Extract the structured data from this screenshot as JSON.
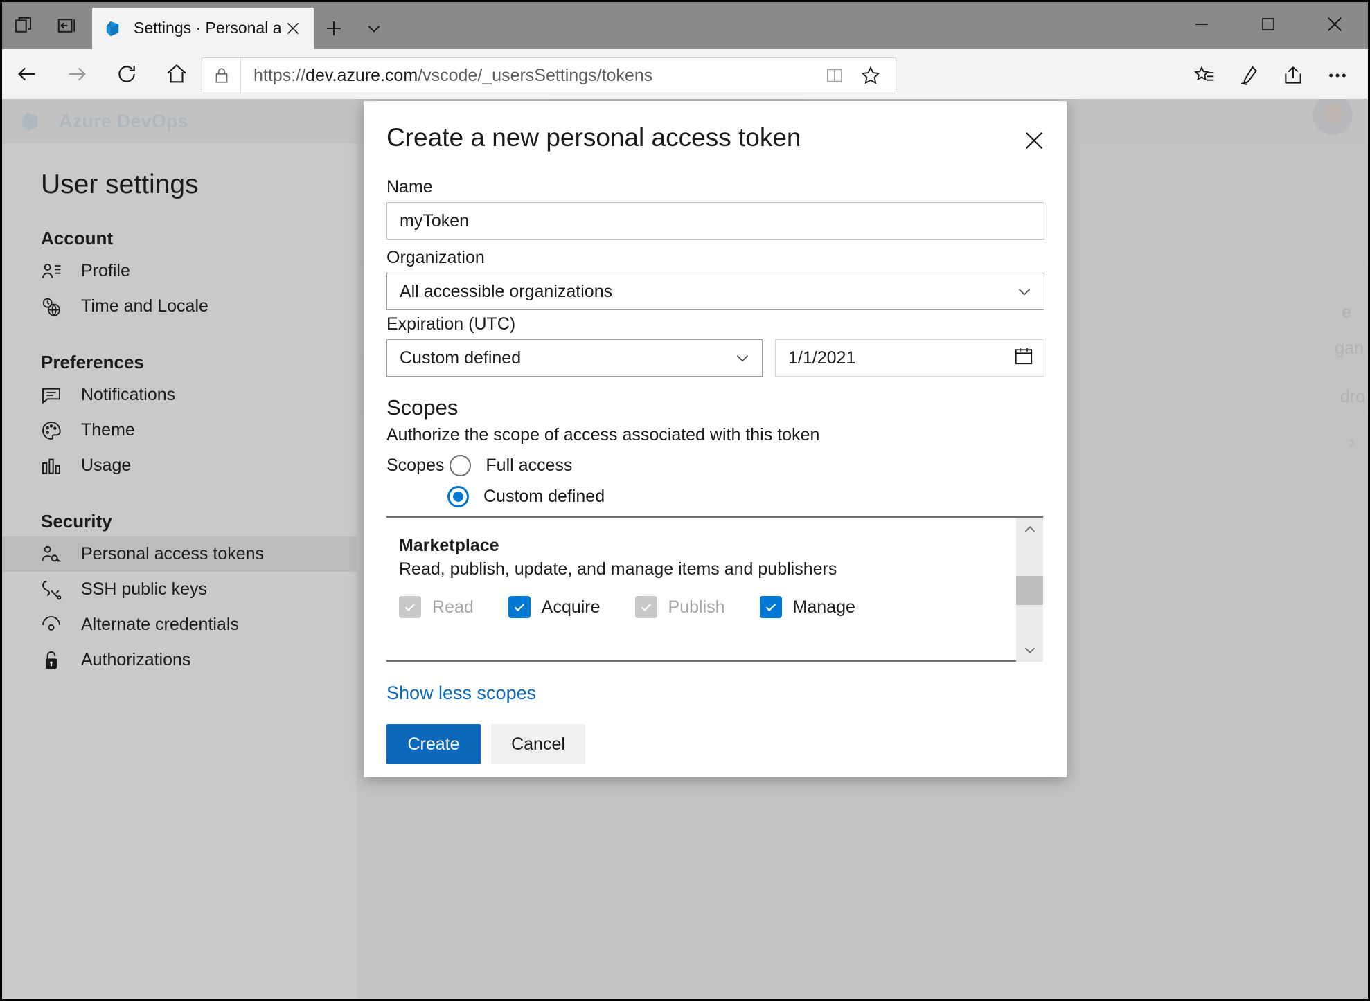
{
  "browser": {
    "tab": {
      "title": "Settings · Personal acceː",
      "favicon": "azure-devops-favicon"
    },
    "newtab_label": "+",
    "url_prefix": "https://",
    "url_domain": "dev.azure.com",
    "url_path": "/vscode/_usersSettings/tokens",
    "url_full": "https://dev.azure.com/vscode/_usersSettings/tokens",
    "window_controls": {
      "minimize": "minimize-icon",
      "maximize": "maximize-icon",
      "close": "close-icon"
    }
  },
  "app": {
    "brand": "Azure DevOps",
    "brand_color": "#0b68bb",
    "accent_color": "#0078d4"
  },
  "sidebar": {
    "title": "User settings",
    "sections": [
      {
        "heading": "Account",
        "items": [
          {
            "label": "Profile",
            "icon": "profile-icon",
            "selected": false
          },
          {
            "label": "Time and Locale",
            "icon": "clock-globe-icon",
            "selected": false
          }
        ]
      },
      {
        "heading": "Preferences",
        "items": [
          {
            "label": "Notifications",
            "icon": "notifications-icon",
            "selected": false
          },
          {
            "label": "Theme",
            "icon": "palette-icon",
            "selected": false
          },
          {
            "label": "Usage",
            "icon": "usage-bar-chart-icon",
            "selected": false
          }
        ]
      },
      {
        "heading": "Security",
        "items": [
          {
            "label": "Personal access tokens",
            "icon": "person-key-icon",
            "selected": true
          },
          {
            "label": "SSH public keys",
            "icon": "ssh-key-icon",
            "selected": false
          },
          {
            "label": "Alternate credentials",
            "icon": "alternate-credentials-icon",
            "selected": false
          },
          {
            "label": "Authorizations",
            "icon": "unlock-icon",
            "selected": false
          }
        ]
      }
    ]
  },
  "background_page": {
    "fragments": [
      "e",
      "gan",
      "dro"
    ],
    "chevron": "›"
  },
  "modal": {
    "title": "Create a new personal access token",
    "close_icon": "close-icon",
    "name": {
      "label": "Name",
      "value": "myToken",
      "placeholder": ""
    },
    "organization": {
      "label": "Organization",
      "value": "All accessible organizations",
      "chevron": "chevron-down-icon"
    },
    "expiration": {
      "label": "Expiration (UTC)",
      "preset_value": "Custom defined",
      "chevron": "chevron-down-icon",
      "date_value": "1/1/2021",
      "calendar_icon": "calendar-icon"
    },
    "scopes": {
      "heading": "Scopes",
      "description": "Authorize the scope of access associated with this token",
      "radio_prefix": "Scopes",
      "options": [
        {
          "label": "Full access",
          "checked": false
        },
        {
          "label": "Custom defined",
          "checked": true
        }
      ],
      "groups": [
        {
          "name": "Marketplace",
          "description": "Read, publish, update, and manage items and publishers",
          "permissions": [
            {
              "label": "Read",
              "checked": true,
              "disabled": true
            },
            {
              "label": "Acquire",
              "checked": true,
              "disabled": false
            },
            {
              "label": "Publish",
              "checked": true,
              "disabled": true
            },
            {
              "label": "Manage",
              "checked": true,
              "disabled": false
            }
          ]
        }
      ],
      "scrollbar": {
        "up_icon": "chevron-up-icon",
        "down_icon": "chevron-down-icon"
      }
    },
    "show_less_link": "Show less scopes",
    "buttons": {
      "create": "Create",
      "cancel": "Cancel"
    }
  }
}
